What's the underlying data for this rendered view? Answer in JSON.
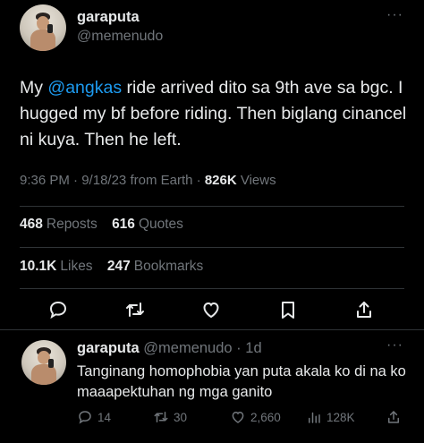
{
  "tweet": {
    "author_name": "garaputa",
    "author_handle": "@memenudo",
    "text_prefix": "My ",
    "mention": "@angkas",
    "text_suffix": " ride arrived dito sa 9th ave sa bgc. I hugged my bf before riding. Then biglang cinancel ni kuya. Then he left.",
    "time": "9:36 PM",
    "date": "9/18/23",
    "source": "from Earth",
    "views_count": "826K",
    "views_label": "Views",
    "reposts_count": "468",
    "reposts_label": "Reposts",
    "quotes_count": "616",
    "quotes_label": "Quotes",
    "likes_count": "10.1K",
    "likes_label": "Likes",
    "bookmarks_count": "247",
    "bookmarks_label": "Bookmarks",
    "more_label": "···",
    "actions": [
      "reply-icon",
      "repost-icon",
      "like-icon",
      "bookmark-icon",
      "share-icon"
    ]
  },
  "reply": {
    "author_name": "garaputa",
    "author_handle": "@memenudo",
    "age": "1d",
    "text": "Tanginang homophobia yan puta akala ko di na ko maaapektuhan ng mga ganito",
    "replies": "14",
    "reposts": "30",
    "likes": "2,660",
    "views": "128K",
    "more_label": "···"
  },
  "colors": {
    "background": "#000000",
    "text": "#e7e9ea",
    "muted": "#71767b",
    "link": "#1d9bf0",
    "divider": "#2f3336"
  }
}
